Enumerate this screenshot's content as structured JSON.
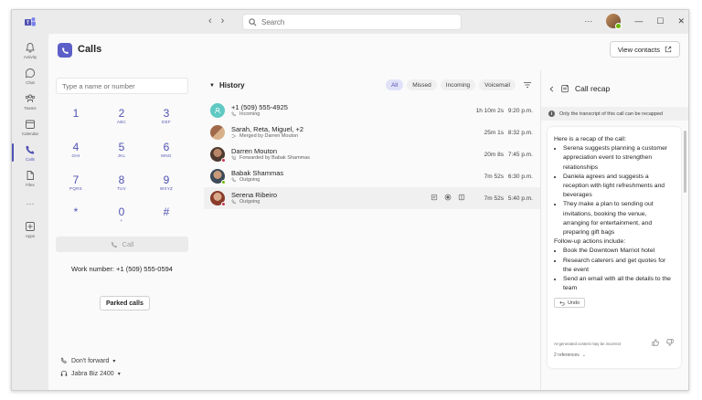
{
  "titlebar": {
    "search_placeholder": "Search",
    "more": "···",
    "minimize": "—",
    "maximize": "☐",
    "close": "✕"
  },
  "rail": [
    {
      "label": "Activity",
      "icon": "bell-icon"
    },
    {
      "label": "Chat",
      "icon": "chat-icon"
    },
    {
      "label": "Teams",
      "icon": "teams-icon"
    },
    {
      "label": "Calendar",
      "icon": "calendar-icon"
    },
    {
      "label": "Calls",
      "icon": "phone-icon",
      "active": true
    },
    {
      "label": "Files",
      "icon": "file-icon"
    },
    {
      "label": "···",
      "icon": "more-icon"
    },
    {
      "label": "Apps",
      "icon": "apps-icon"
    }
  ],
  "header": {
    "title": "Calls",
    "view_contacts": "View contacts"
  },
  "dialpad": {
    "placeholder": "Type a name or number",
    "keys": [
      {
        "digit": "1",
        "letters": ""
      },
      {
        "digit": "2",
        "letters": "ABC"
      },
      {
        "digit": "3",
        "letters": "DEF"
      },
      {
        "digit": "4",
        "letters": "GHI"
      },
      {
        "digit": "5",
        "letters": "JKL"
      },
      {
        "digit": "6",
        "letters": "MNO"
      },
      {
        "digit": "7",
        "letters": "PQRS"
      },
      {
        "digit": "8",
        "letters": "TUV"
      },
      {
        "digit": "9",
        "letters": "WXYZ"
      },
      {
        "digit": "*",
        "letters": ""
      },
      {
        "digit": "0",
        "letters": "+"
      },
      {
        "digit": "#",
        "letters": ""
      }
    ],
    "call_label": "Call",
    "work_number": "Work number: +1 (509) 555-0594",
    "parked_calls": "Parked calls",
    "forward": "Don't forward",
    "device": "Jabra Biz 2400"
  },
  "history": {
    "title": "History",
    "filters": [
      "All",
      "Missed",
      "Incoming",
      "Voicemail"
    ],
    "active_filter": "All",
    "rows": [
      {
        "name": "+1 (509) 555-4925",
        "sub": "Incoming",
        "duration": "1h 10m 2s",
        "time": "9:20 p.m.",
        "avatar_color": "#5fc9c2",
        "status": ""
      },
      {
        "name": "Sarah, Reta, Miguel, +2",
        "sub": "Merged by Darren Mouton",
        "duration": "25m 1s",
        "time": "8:32 p.m.",
        "avatar_color": "#a0694a",
        "status": ""
      },
      {
        "name": "Darren Mouton",
        "sub": "Forwarded by Babak Shammas",
        "duration": "20m 8s",
        "time": "7:45 p.m.",
        "avatar_color": "#6b4f3f",
        "status": "#c4314b"
      },
      {
        "name": "Babak Shammas",
        "sub": "Outgoing",
        "duration": "7m 52s",
        "time": "6:30 p.m.",
        "avatar_color": "#4a5b6b",
        "status": "#6bb700"
      },
      {
        "name": "Serena Ribeiro",
        "sub": "Outgoing",
        "duration": "7m 52s",
        "time": "5:40 p.m.",
        "avatar_color": "#b0543c",
        "status": "#c4314b"
      }
    ]
  },
  "recap": {
    "title": "Call recap",
    "notice": "Only the transcript of this call can be recapped",
    "intro": "Here is a recap of the call:",
    "points": [
      "Serena suggests planning a customer appreciation event to strengthen relationships",
      "Daniela agrees and suggests a reception with light refreshments and beverages",
      "They make a plan to sending out invitations, booking the venue, arranging for entertainment, and preparing gift bags"
    ],
    "followup_label": "Follow-up actions include:",
    "followups": [
      "Book the Downtown Marriot hotel",
      "Research caterers and get quotes for the event",
      "Send an email with all the details to the team"
    ],
    "undo": "Undo",
    "ai_note": "AI-generated content may be incorrect",
    "references": "2 references"
  }
}
